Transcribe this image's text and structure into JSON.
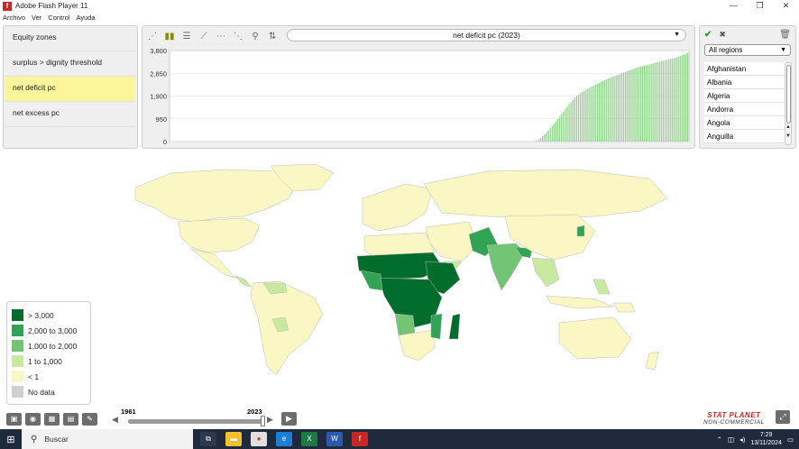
{
  "window": {
    "title": "Adobe Flash Player 11",
    "controls": [
      "—",
      "❐",
      "✕"
    ]
  },
  "menubar": [
    "Archivo",
    "Ver",
    "Control",
    "Ayuda"
  ],
  "indicators": [
    {
      "label": "Equity zones",
      "active": false
    },
    {
      "label": "surplus > dignity threshold",
      "active": false
    },
    {
      "label": "net deficit pc",
      "active": true
    },
    {
      "label": "net excess pc",
      "active": false
    }
  ],
  "chart_toolbar": {
    "icons": [
      "scatter-icon",
      "bar-chart-icon",
      "horizontal-bar-icon",
      "line-chart-icon",
      "line-dots-icon",
      "scatter-trend-icon",
      "zoom-icon",
      "sort-icon"
    ],
    "selected_indicator": "net deficit pc (2023)"
  },
  "chart_data": {
    "type": "bar",
    "title": "",
    "xlabel": "",
    "ylabel": "",
    "ylim": [
      0,
      3800
    ],
    "yticks": [
      "3,800",
      "2,850",
      "1,900",
      "950",
      "0"
    ],
    "ytick_values": [
      3800,
      2850,
      1900,
      950,
      0
    ],
    "values": [
      0,
      0,
      0,
      0,
      0,
      0,
      0,
      0,
      0,
      0,
      0,
      0,
      0,
      0,
      0,
      0,
      0,
      0,
      0,
      0,
      0,
      0,
      0,
      0,
      0,
      0,
      0,
      0,
      0,
      0,
      0,
      0,
      0,
      0,
      0,
      0,
      0,
      0,
      0,
      0,
      0,
      0,
      0,
      0,
      0,
      0,
      0,
      0,
      0,
      0,
      0,
      0,
      0,
      0,
      0,
      0,
      0,
      0,
      0,
      0,
      0,
      0,
      0,
      0,
      0,
      0,
      0,
      0,
      0,
      0,
      0,
      0,
      0,
      0,
      0,
      0,
      0,
      0,
      0,
      0,
      0,
      0,
      0,
      0,
      0,
      0,
      0,
      0,
      0,
      0,
      0,
      0,
      0,
      0,
      0,
      0,
      0,
      0,
      0,
      0,
      0,
      0,
      0,
      0,
      0,
      0,
      0,
      0,
      0,
      0,
      0,
      0,
      0,
      0,
      0,
      0,
      0,
      0,
      0,
      0,
      0,
      0,
      0,
      0,
      0,
      0,
      0,
      0,
      0,
      0,
      0,
      0,
      0,
      0,
      0,
      0,
      0,
      0,
      0,
      0,
      0,
      0,
      0,
      0,
      0,
      0,
      0,
      0,
      0,
      0,
      0,
      0,
      0,
      0,
      0,
      0,
      0,
      0,
      0,
      0,
      0,
      0,
      0,
      0,
      0,
      0,
      0,
      0,
      0,
      0,
      0,
      0,
      0,
      0,
      0,
      0,
      0,
      0,
      0,
      0,
      0,
      0,
      0,
      0,
      0,
      0,
      0,
      0,
      0,
      0,
      0,
      0,
      0,
      0,
      0,
      40,
      90,
      150,
      220,
      300,
      380,
      470,
      560,
      650,
      750,
      850,
      950,
      1050,
      1150,
      1250,
      1350,
      1450,
      1550,
      1650,
      1750,
      1830,
      1900,
      1960,
      2020,
      2070,
      2120,
      2170,
      2210,
      2250,
      2290,
      2330,
      2370,
      2410,
      2450,
      2490,
      2530,
      2570,
      2610,
      2640,
      2670,
      2700,
      2730,
      2760,
      2790,
      2820,
      2850,
      2880,
      2910,
      2940,
      2970,
      3000,
      3030,
      3060,
      3090,
      3110,
      3130,
      3150,
      3170,
      3190,
      3210,
      3230,
      3250,
      3270,
      3290,
      3310,
      3330,
      3350,
      3370,
      3390,
      3410,
      3430,
      3450,
      3470,
      3490,
      3510,
      3540,
      3570,
      3600,
      3630,
      3660,
      3700
    ]
  },
  "region_panel": {
    "selected_region": "All regions",
    "countries": [
      "Afghanistan",
      "Albania",
      "Algeria",
      "Andorra",
      "Angola",
      "Anguilla"
    ]
  },
  "legend": {
    "items": [
      {
        "label": "> 3,000",
        "color": "#006d2c"
      },
      {
        "label": "2,000 to 3,000",
        "color": "#31a354"
      },
      {
        "label": "1,000 to 2,000",
        "color": "#74c476"
      },
      {
        "label": "1 to 1,000",
        "color": "#c7e9a0"
      },
      {
        "label": "< 1",
        "color": "#fbf7c4"
      },
      {
        "label": "No data",
        "color": "#d0d0d0"
      }
    ]
  },
  "timeline": {
    "start_year": "1961",
    "end_year": "2023",
    "position": 1.0
  },
  "brand": {
    "line1": "STAT PLANET",
    "line2": "NON-COMMERCIAL"
  },
  "taskbar": {
    "search_placeholder": "Buscar",
    "time": "7:29",
    "date": "13/11/2024"
  }
}
